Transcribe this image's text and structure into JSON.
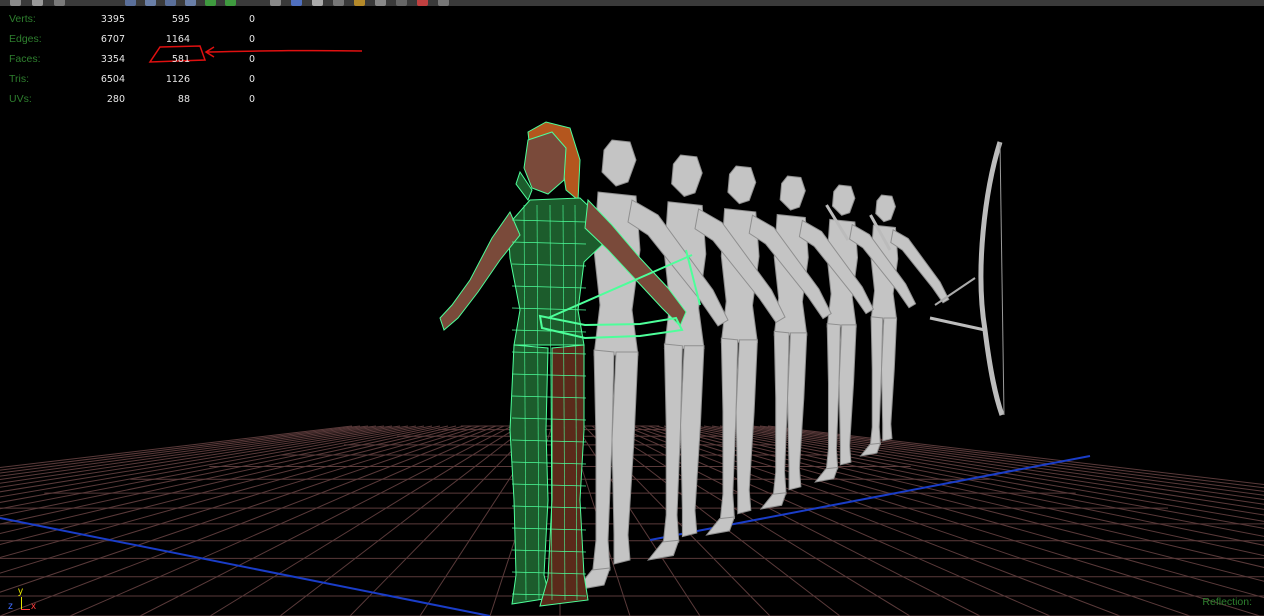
{
  "toolbar": {
    "icons": [
      "select-tool-icon",
      "move-tool-icon",
      "rotate-tool-icon",
      "panel-layout-icon",
      "panel-layout-icon",
      "panel-layout-icon",
      "panel-layout-icon",
      "panel-layout-icon",
      "panel-layout-icon",
      "cube-shading-icon",
      "cube-shading-icon",
      "sphere-shading-icon",
      "texture-icon",
      "light-icon",
      "camera-icon",
      "isolate-icon",
      "xray-icon",
      "grid-icon"
    ]
  },
  "hud": {
    "rows": [
      {
        "label": "Verts:",
        "v1": "3395",
        "v2": "595",
        "v3": "0"
      },
      {
        "label": "Edges:",
        "v1": "6707",
        "v2": "1164",
        "v3": "0"
      },
      {
        "label": "Faces:",
        "v1": "3354",
        "v2": "581",
        "v3": "0"
      },
      {
        "label": "Tris:",
        "v1": "6504",
        "v2": "1126",
        "v3": "0"
      },
      {
        "label": "UVs:",
        "v1": "280",
        "v2": "88",
        "v3": "0"
      }
    ]
  },
  "annotation": {
    "highlighted_value": "581",
    "color": "#e01010"
  },
  "axis": {
    "y": "y",
    "z": "z",
    "x": "x"
  },
  "status": {
    "reflection": "Reflection:"
  },
  "colors": {
    "background": "#000000",
    "grid": "#5a3a3a",
    "axis_line": "#1a3dc8",
    "wireframe": "#4dff9a",
    "hud_label": "#2e7f2e",
    "hud_value": "#e8e8e8",
    "model_fill": "#c4c4c4",
    "hair": "#b4561e"
  }
}
